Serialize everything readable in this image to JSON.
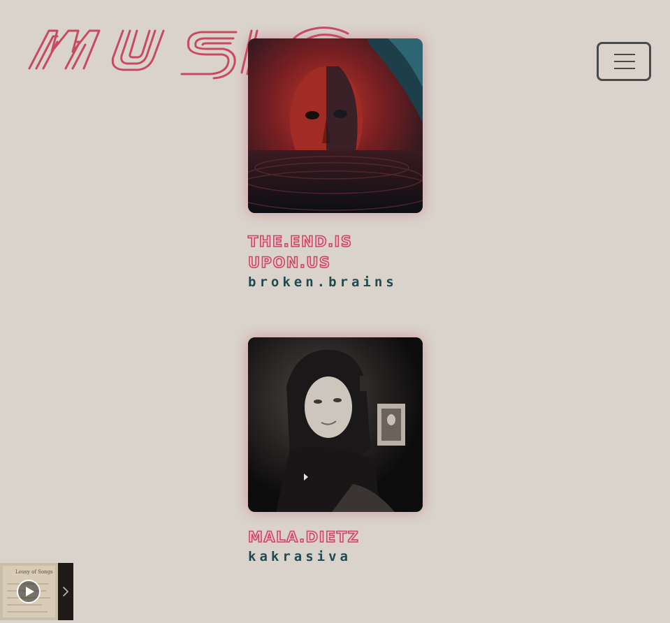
{
  "header": {
    "logo_text": "MUSIC",
    "menu_label": "Toggle navigation"
  },
  "albums": [
    {
      "title": "the.end.is upon.us",
      "artist": "broken.brains",
      "cover_alt": "the.end.is upon.us cover art"
    },
    {
      "title": "mala.dietz",
      "artist": "kakrasiva",
      "cover_alt": "mala.dietz cover art"
    }
  ],
  "player": {
    "thumb_caption": "Lousy of Songs",
    "play_label": "Play",
    "expand_label": "Expand player"
  },
  "colors": {
    "background": "#d9d3cb",
    "title_fill": "#f2c3cc",
    "title_stroke": "#c84a62",
    "artist": "#1f4a52",
    "logo": "#c84a62"
  }
}
